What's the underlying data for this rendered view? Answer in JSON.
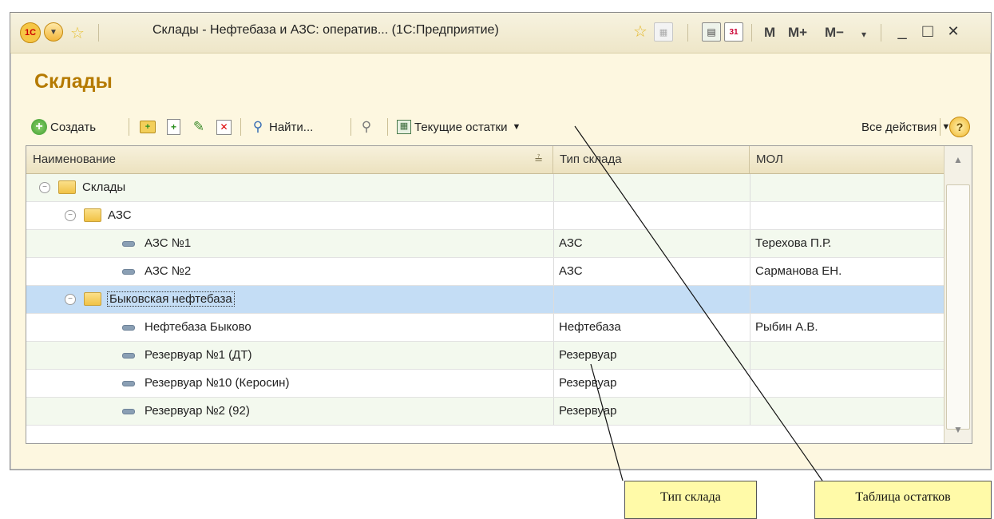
{
  "window": {
    "title": "Склады - Нефтебаза и АЗС: оператив... (1С:Предприятие)",
    "logo": "1С",
    "m": "M",
    "m_plus": "M+",
    "m_minus": "M−",
    "minimize": "_",
    "maximize": "□",
    "close": "✕",
    "calendar_day": "31"
  },
  "form": {
    "title": "Склады"
  },
  "toolbar": {
    "create": "Создать",
    "find": "Найти...",
    "balances": "Текущие остатки",
    "all_actions": "Все действия",
    "help": "?"
  },
  "table": {
    "columns": [
      "Наименование",
      "Тип склада",
      "МОЛ"
    ],
    "rows": [
      {
        "level": 0,
        "kind": "group",
        "name": "Склады",
        "type": "",
        "mol": ""
      },
      {
        "level": 1,
        "kind": "group",
        "name": "АЗС",
        "type": "",
        "mol": ""
      },
      {
        "level": 2,
        "kind": "item",
        "name": "АЗС №1",
        "type": "АЗС",
        "mol": "Терехова П.Р."
      },
      {
        "level": 2,
        "kind": "item",
        "name": "АЗС №2",
        "type": "АЗС",
        "mol": "Сарманова ЕН."
      },
      {
        "level": 1,
        "kind": "group",
        "name": "Быковская нефтебаза",
        "type": "",
        "mol": "",
        "selected": true
      },
      {
        "level": 2,
        "kind": "item",
        "name": "Нефтебаза Быково",
        "type": "Нефтебаза",
        "mol": "Рыбин А.В."
      },
      {
        "level": 2,
        "kind": "item",
        "name": "Резервуар №1 (ДТ)",
        "type": "Резервуар",
        "mol": ""
      },
      {
        "level": 2,
        "kind": "item",
        "name": "Резервуар №10 (Керосин)",
        "type": "Резервуар",
        "mol": ""
      },
      {
        "level": 2,
        "kind": "item",
        "name": "Резервуар №2 (92)",
        "type": "Резервуар",
        "mol": ""
      }
    ]
  },
  "callouts": {
    "warehouse_type": "Тип склада",
    "balances_table": "Таблица остатков"
  },
  "colors": {
    "title_accent": "#b57a00",
    "selection": "#c4ddf5",
    "callout_bg": "#fffaa8"
  }
}
